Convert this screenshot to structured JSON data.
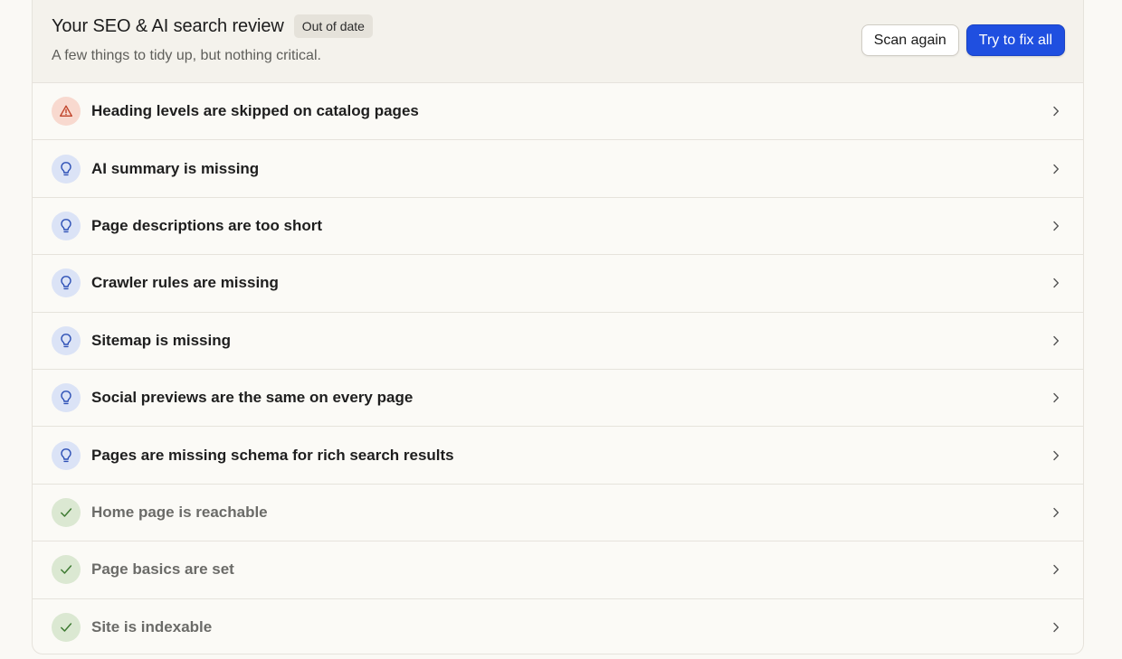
{
  "header": {
    "title": "Your SEO & AI search review",
    "badge": "Out of date",
    "subtitle": "A few things to tidy up, but nothing critical.",
    "scan_again_label": "Scan again",
    "fix_all_label": "Try to fix all"
  },
  "colors": {
    "primary_button": "#1f4fe0",
    "warning_bg": "#f8d9cf",
    "warning_icon": "#c0442a",
    "suggestion_bg": "#dbe3f6",
    "suggestion_icon": "#2c4fb5",
    "passed_bg": "#dbe8d2",
    "passed_icon": "#3e7a32"
  },
  "items": [
    {
      "label": "Heading levels are skipped on catalog pages",
      "status": "warning",
      "icon": "warning-triangle-icon"
    },
    {
      "label": "AI summary is missing",
      "status": "suggestion",
      "icon": "lightbulb-icon"
    },
    {
      "label": "Page descriptions are too short",
      "status": "suggestion",
      "icon": "lightbulb-icon"
    },
    {
      "label": "Crawler rules are missing",
      "status": "suggestion",
      "icon": "lightbulb-icon"
    },
    {
      "label": "Sitemap is missing",
      "status": "suggestion",
      "icon": "lightbulb-icon"
    },
    {
      "label": "Social previews are the same on every page",
      "status": "suggestion",
      "icon": "lightbulb-icon"
    },
    {
      "label": "Pages are missing schema for rich search results",
      "status": "suggestion",
      "icon": "lightbulb-icon"
    },
    {
      "label": "Home page is reachable",
      "status": "passed",
      "icon": "checkmark-icon"
    },
    {
      "label": "Page basics are set",
      "status": "passed",
      "icon": "checkmark-icon"
    },
    {
      "label": "Site is indexable",
      "status": "passed",
      "icon": "checkmark-icon"
    }
  ]
}
